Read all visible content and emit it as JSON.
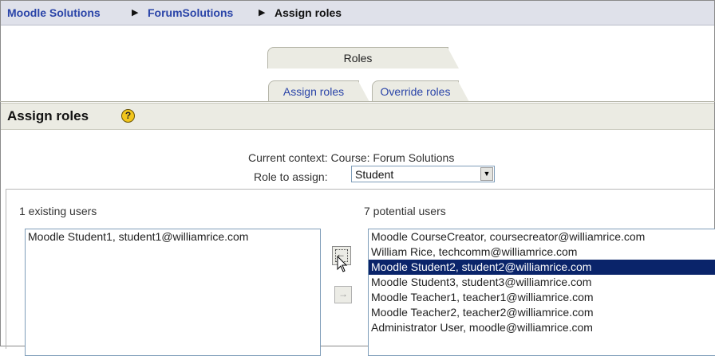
{
  "breadcrumb": {
    "items": [
      "Moodle Solutions",
      "ForumSolutions"
    ],
    "current": "Assign roles",
    "separator": "▶"
  },
  "tabs": {
    "top": "Roles",
    "second_row": [
      "Assign roles",
      "Override roles"
    ]
  },
  "section": {
    "title": "Assign roles",
    "help_icon": "help-icon"
  },
  "context": {
    "text": "Current context: Course: Forum Solutions"
  },
  "role_select": {
    "label": "Role to assign:",
    "value": "Student"
  },
  "existing": {
    "label": "1 existing users",
    "users": [
      "Moodle Student1, student1@williamrice.com"
    ]
  },
  "potential": {
    "label": "7 potential users",
    "users": [
      "Moodle CourseCreator, coursecreator@williamrice.com",
      "William Rice, techcomm@williamrice.com",
      "Moodle Student2, student2@williamrice.com",
      "Moodle Student3, student3@williamrice.com",
      "Moodle Teacher1, teacher1@williamrice.com",
      "Moodle Teacher2, teacher2@williamrice.com",
      "Administrator User, moodle@williamrice.com"
    ],
    "selected_index": 2
  },
  "buttons": {
    "add_icon": "arrow-left-icon",
    "remove_icon": "arrow-right-icon",
    "add_glyph": "←",
    "remove_glyph": "→"
  },
  "colors": {
    "link": "#2a44a8",
    "selected_bg": "#0a246a",
    "navbar_bg": "#dfe1ea",
    "section_bg": "#ebebe3"
  }
}
